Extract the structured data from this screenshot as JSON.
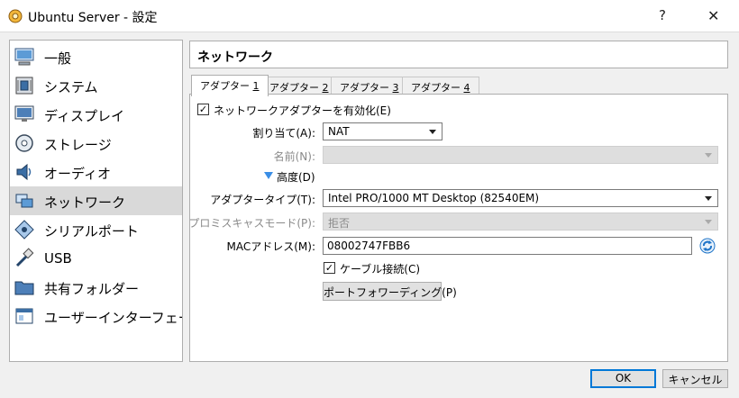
{
  "window": {
    "title": "Ubuntu Server - 設定",
    "help": "?",
    "close": "✕"
  },
  "sidebar": {
    "items": [
      {
        "label": "一般",
        "icon": "monitor-icon"
      },
      {
        "label": "システム",
        "icon": "chip-icon"
      },
      {
        "label": "ディスプレイ",
        "icon": "display-icon"
      },
      {
        "label": "ストレージ",
        "icon": "disk-icon"
      },
      {
        "label": "オーディオ",
        "icon": "speaker-icon"
      },
      {
        "label": "ネットワーク",
        "icon": "network-icon"
      },
      {
        "label": "シリアルポート",
        "icon": "serial-port-icon"
      },
      {
        "label": "USB",
        "icon": "usb-icon"
      },
      {
        "label": "共有フォルダー",
        "icon": "folder-icon"
      },
      {
        "label": "ユーザーインターフェース",
        "icon": "ui-window-icon"
      }
    ],
    "selected": "ネットワーク"
  },
  "header": {
    "title": "ネットワーク"
  },
  "tabs": [
    {
      "label": "アダプター",
      "num": "1"
    },
    {
      "label": "アダプター",
      "num": "2"
    },
    {
      "label": "アダプター",
      "num": "3"
    },
    {
      "label": "アダプター",
      "num": "4"
    }
  ],
  "form": {
    "enable_adapter": {
      "label": "ネットワークアダプターを有効化(E)",
      "checked": true
    },
    "attached_to": {
      "label": "割り当て(A):",
      "value": "NAT"
    },
    "name": {
      "label": "名前(N):",
      "value": ""
    },
    "advanced": {
      "label": "高度(D)"
    },
    "adapter_type": {
      "label": "アダプタータイプ(T):",
      "value": "Intel PRO/1000 MT Desktop (82540EM)"
    },
    "promiscuous": {
      "label": "プロミスキャスモード(P):",
      "value": "拒否"
    },
    "mac": {
      "label": "MACアドレス(M):",
      "value": "08002747FBB6"
    },
    "cable": {
      "label": "ケーブル接続(C)",
      "checked": true
    },
    "port_forwarding": {
      "label": "ポートフォワーディング(P)"
    }
  },
  "buttons": {
    "ok": "OK",
    "cancel": "キャンセル"
  },
  "colors": {
    "selection": "#d9d9d9",
    "accent": "#0078d7",
    "refresh": "#1e74c8"
  }
}
